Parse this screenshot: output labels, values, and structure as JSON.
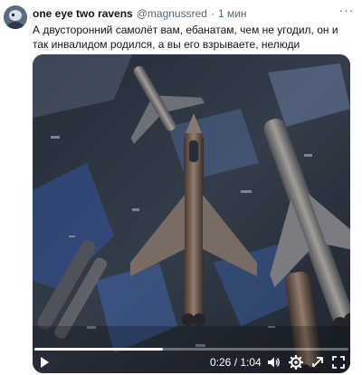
{
  "tweet": {
    "author_name": "one eye two ravens",
    "handle": "@magnussred",
    "separator": "·",
    "time": "1 мин",
    "more_label": "···",
    "text": "А двусторонний самолёт вам, ебанатам, чем не угодил, он и так инвалидом родился, а вы его взрываете, нелюди"
  },
  "video": {
    "timecode": "0:26 / 1:04",
    "progress": 0.41,
    "state": "paused",
    "icons": [
      "play-icon",
      "volume-icon",
      "settings-icon",
      "expand-icon",
      "fullscreen-icon"
    ]
  }
}
